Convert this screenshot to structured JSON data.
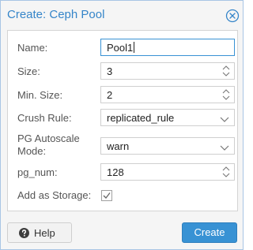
{
  "dialog": {
    "title": "Create: Ceph Pool"
  },
  "form": {
    "name": {
      "label": "Name:",
      "value": "Pool1"
    },
    "size": {
      "label": "Size:",
      "value": "3"
    },
    "min_size": {
      "label": "Min. Size:",
      "value": "2"
    },
    "crush_rule": {
      "label": "Crush Rule:",
      "value": "replicated_rule"
    },
    "pg_autoscale_mode": {
      "label_line1": "PG Autoscale",
      "label_line2": "Mode:",
      "value": "warn"
    },
    "pg_num": {
      "label": "pg_num:",
      "value": "128"
    },
    "add_as_storage": {
      "label": "Add as Storage:",
      "checked": true
    }
  },
  "footer": {
    "help_label": "Help",
    "create_label": "Create"
  },
  "colors": {
    "accent": "#3892d4",
    "title": "#3585c9"
  }
}
